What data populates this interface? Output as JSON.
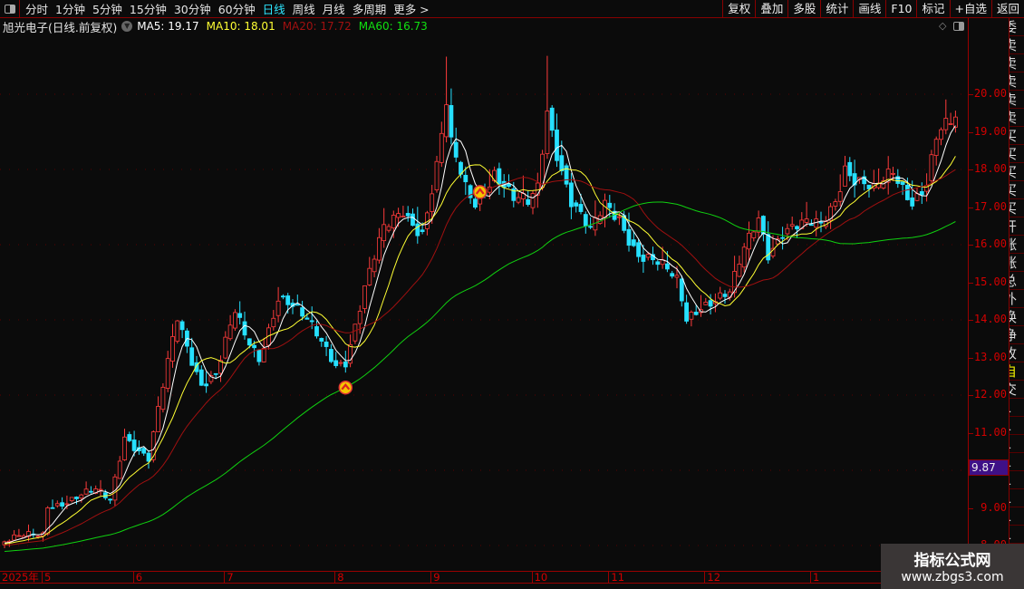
{
  "toolbar": {
    "periods": [
      "分时",
      "1分钟",
      "5分钟",
      "15分钟",
      "30分钟",
      "60分钟",
      "日线",
      "周线",
      "月线",
      "多周期",
      "更多 >"
    ],
    "active_period": "日线",
    "right_buttons": [
      "复权",
      "叠加",
      "多股",
      "统计",
      "画线",
      "F10",
      "标记",
      "+自选",
      "返回"
    ]
  },
  "info": {
    "title": "旭光电子(日线.前复权)",
    "ma5": "MA5: 19.17",
    "ma10": "MA10: 18.01",
    "ma20": "MA20: 17.72",
    "ma60": "MA60: 16.73"
  },
  "colors": {
    "up": "#ff3b3b",
    "down": "#26e0ff",
    "ma5": "#ffffff",
    "ma10": "#ffff33",
    "ma20": "#a01010",
    "ma60": "#10d010",
    "axis": "#d40000"
  },
  "current_price": "9.87",
  "side_labels": [
    "委",
    "卖",
    "卖",
    "卖",
    "卖",
    "卖",
    "买",
    "买",
    "买",
    "买",
    "买",
    "开",
    "涨",
    "涨",
    "总",
    "外",
    "换",
    "净",
    "收",
    "自",
    "交",
    "1",
    "1",
    "1",
    "1",
    "1",
    "1",
    "1",
    "1",
    "1",
    "1"
  ],
  "watermark": {
    "line1": "指标公式网",
    "line2": "www.zbgs3.com"
  },
  "chart_data": {
    "type": "candlestick",
    "title": "旭光电子(日线.前复权)",
    "y_ticks": [
      "20.00",
      "19.00",
      "18.00",
      "17.00",
      "16.00",
      "15.00",
      "14.00",
      "13.00",
      "12.00",
      "11.00",
      "9.00",
      "8.00"
    ],
    "ylim": [
      7.9,
      21.6
    ],
    "x_labels": [
      {
        "label": "2025年",
        "day": -9
      },
      {
        "label": "5",
        "day": 0
      },
      {
        "label": "6",
        "day": 19
      },
      {
        "label": "7",
        "day": 38
      },
      {
        "label": "8",
        "day": 61
      },
      {
        "label": "9",
        "day": 81
      },
      {
        "label": "10",
        "day": 102
      },
      {
        "label": "11",
        "day": 118
      },
      {
        "label": "12",
        "day": 138
      },
      {
        "label": "1",
        "day": 160
      }
    ],
    "close_keypoints": [
      [
        0,
        8.1
      ],
      [
        8,
        8.3
      ],
      [
        9,
        9.1
      ],
      [
        19,
        9.4
      ],
      [
        22,
        9.2
      ],
      [
        25,
        11.0
      ],
      [
        30,
        10.3
      ],
      [
        36,
        14.0
      ],
      [
        39,
        13.0
      ],
      [
        41,
        12.4
      ],
      [
        44,
        12.6
      ],
      [
        48,
        14.1
      ],
      [
        50,
        13.5
      ],
      [
        53,
        13.0
      ],
      [
        57,
        14.7
      ],
      [
        59,
        14.5
      ],
      [
        64,
        13.7
      ],
      [
        69,
        12.9
      ],
      [
        71,
        13.0
      ],
      [
        75,
        14.8
      ],
      [
        79,
        16.3
      ],
      [
        83,
        17.0
      ],
      [
        87,
        16.4
      ],
      [
        90,
        18.0
      ],
      [
        92,
        19.6
      ],
      [
        93,
        18.5
      ],
      [
        96,
        17.5
      ],
      [
        98,
        17.2
      ],
      [
        102,
        18.0
      ],
      [
        106,
        17.1
      ],
      [
        109,
        17.0
      ],
      [
        111,
        17.5
      ],
      [
        113,
        19.7
      ],
      [
        115,
        18.6
      ],
      [
        118,
        17.2
      ],
      [
        122,
        16.2
      ],
      [
        125,
        17.0
      ],
      [
        128,
        16.8
      ],
      [
        132,
        15.8
      ],
      [
        136,
        15.4
      ],
      [
        140,
        15.0
      ],
      [
        142,
        14.1
      ],
      [
        145,
        14.5
      ],
      [
        151,
        14.6
      ],
      [
        154,
        15.8
      ],
      [
        157,
        16.8
      ],
      [
        159,
        15.9
      ],
      [
        162,
        16.4
      ],
      [
        166,
        16.4
      ],
      [
        170,
        16.5
      ],
      [
        173,
        17.3
      ],
      [
        175,
        18.2
      ],
      [
        177,
        17.8
      ],
      [
        181,
        17.3
      ],
      [
        185,
        17.9
      ],
      [
        189,
        17.3
      ],
      [
        192,
        17.7
      ],
      [
        194,
        18.8
      ],
      [
        198,
        19.2
      ]
    ],
    "prehistory_level": 7.6,
    "signals": [
      {
        "day": 71,
        "price": 12.2
      },
      {
        "day": 99,
        "price": 17.4
      }
    ],
    "series": [
      "MA5",
      "MA10",
      "MA20",
      "MA60"
    ]
  }
}
